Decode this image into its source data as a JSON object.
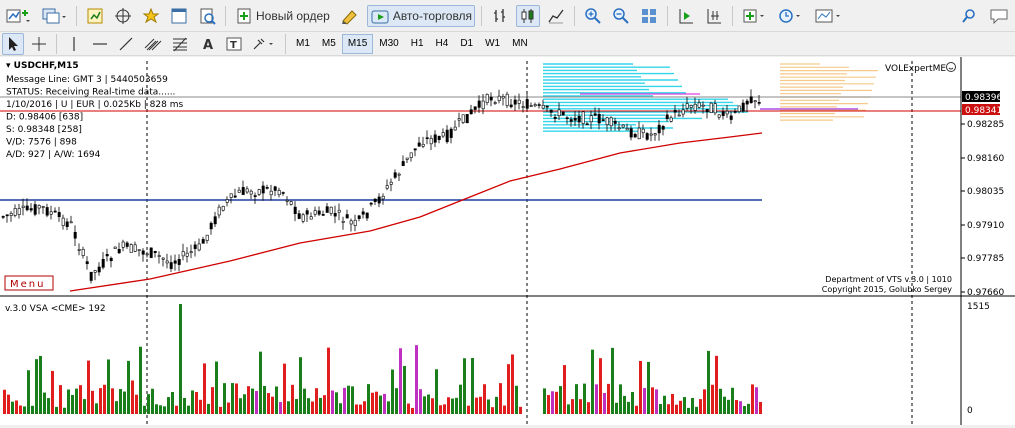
{
  "toolbar": {
    "new_order_label": "Новый ордер",
    "autotrading_label": "Авто-торговля",
    "timeframes": [
      "M1",
      "M5",
      "M15",
      "M30",
      "H1",
      "H4",
      "D1",
      "W1",
      "MN"
    ],
    "active_timeframe": "M15"
  },
  "chart": {
    "symbol_line": "USDCHF,M15",
    "info_lines": [
      "Message Line: GMT 3 | 5440503659",
      "STATUS:  Receiving Real-time data......",
      "1/10/2016 | U | EUR | 0.025Kb | 828 ms",
      "D: 0.98406  [638]",
      "S: 0.98348  [258]",
      "V/D: 7576 | 898",
      "A/D: 927 | A/W: 1694"
    ],
    "watermark": "VOLExpertME",
    "menu_label": "Menu",
    "department": "Department of VTS  v.3.0 | 1010",
    "copyright": "Copyright 2015, Golubko Sergey",
    "price_ticks": [
      "0.98285",
      "0.98160",
      "0.98035",
      "0.97910",
      "0.97785",
      "0.97660"
    ],
    "bid_label": "0.98396",
    "ask_label": "0.98341",
    "indicator_title": "v.3.0 VSA  <CME>  192",
    "volume_max": "1515",
    "volume_min": "0",
    "colors": {
      "bull": "#1a7f1a",
      "bear": "#e01e1e",
      "ma": "#d00000",
      "hline": "#1f3fa0",
      "profile_cyan": "#33d6e8"
    }
  }
}
